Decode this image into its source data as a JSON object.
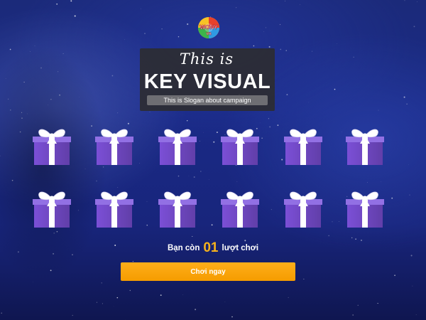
{
  "logo": {
    "text_top": "WONY",
    "text_bottom": "vn"
  },
  "key_visual": {
    "header": "This is",
    "title": "KEY VISUAL",
    "slogan": "This is Slogan about campaign"
  },
  "gifts": {
    "rows": 2,
    "per_row": 6,
    "color": "#7b4fd6",
    "ribbon_color": "#ffffff"
  },
  "turns": {
    "prefix": "Bạn còn",
    "count": "01",
    "suffix": "lượt chơi"
  },
  "play_button": {
    "label": "Chơi ngay"
  },
  "colors": {
    "accent": "#f6b21c",
    "button": "#f7a30a",
    "background": "#1a2a86"
  }
}
